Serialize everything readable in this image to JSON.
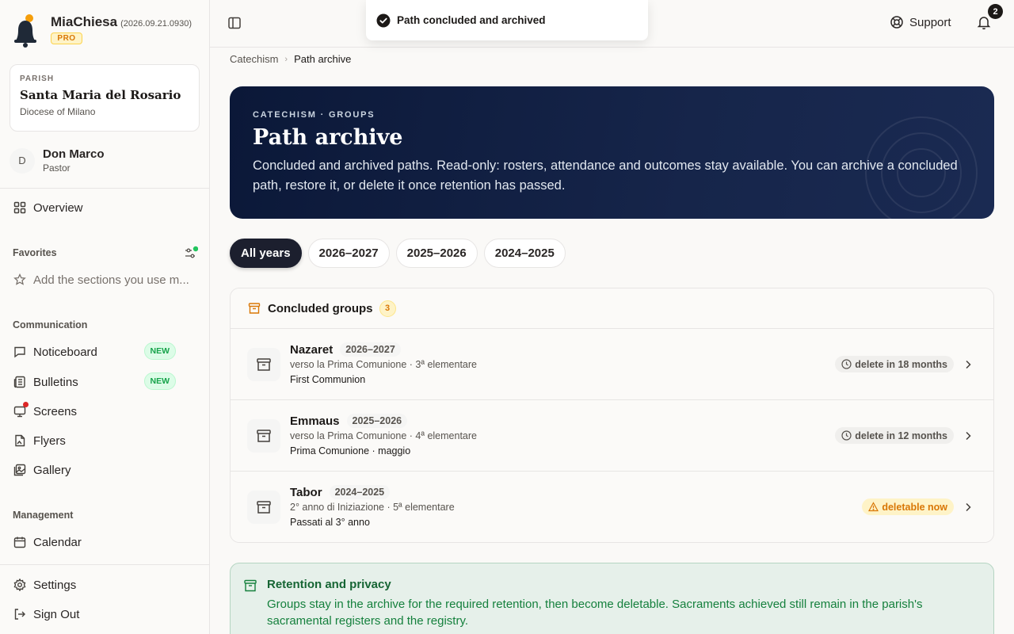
{
  "app": {
    "name": "MiaChiesa",
    "version": "(2026.09.21.0930)",
    "plan": "PRO"
  },
  "parish": {
    "label": "PARISH",
    "name": "Santa Maria del Rosario",
    "diocese": "Diocese of Milano"
  },
  "user": {
    "initial": "D",
    "name": "Don Marco",
    "role": "Pastor"
  },
  "sidebar": {
    "overview": "Overview",
    "favorites_label": "Favorites",
    "favorites_placeholder": "Add the sections you use m...",
    "communication_label": "Communication",
    "communication": [
      {
        "label": "Noticeboard",
        "badge": "NEW"
      },
      {
        "label": "Bulletins",
        "badge": "NEW"
      },
      {
        "label": "Screens"
      },
      {
        "label": "Flyers"
      },
      {
        "label": "Gallery"
      }
    ],
    "management_label": "Management",
    "management": [
      {
        "label": "Calendar"
      }
    ],
    "settings": "Settings",
    "sign_out": "Sign Out"
  },
  "header": {
    "support": "Support",
    "notifications_count": "2"
  },
  "toast": {
    "message": "Path concluded and archived"
  },
  "breadcrumb": {
    "parent": "Catechism",
    "current": "Path archive"
  },
  "hero": {
    "kicker": "CATECHISM · GROUPS",
    "title": "Path archive",
    "description": "Concluded and archived paths. Read-only: rosters, attendance and outcomes stay available. You can archive a concluded path, restore it, or delete it once retention has passed."
  },
  "filters": [
    {
      "label": "All years",
      "active": true
    },
    {
      "label": "2026–2027",
      "active": false
    },
    {
      "label": "2025–2026",
      "active": false
    },
    {
      "label": "2024–2025",
      "active": false
    }
  ],
  "groups": {
    "title": "Concluded groups",
    "count": "3",
    "rows": [
      {
        "name": "Nazaret",
        "year": "2026–2027",
        "sub": "verso la Prima Comunione · 3ª elementare",
        "note": "First Communion",
        "status": "delete in 18 months",
        "status_kind": "clock"
      },
      {
        "name": "Emmaus",
        "year": "2025–2026",
        "sub": "verso la Prima Comunione · 4ª elementare",
        "note": "Prima Comunione · maggio",
        "status": "delete in 12 months",
        "status_kind": "clock"
      },
      {
        "name": "Tabor",
        "year": "2024–2025",
        "sub": "2° anno di Iniziazione · 5ª elementare",
        "note": "Passati al 3° anno",
        "status": "deletable now",
        "status_kind": "warning"
      }
    ]
  },
  "retention": {
    "title": "Retention and privacy",
    "text": "Groups stay in the archive for the required retention, then become deletable. Sacraments achieved still remain in the parish's sacramental registers and the registry."
  },
  "colors": {
    "hero_bg": "#0b1838",
    "accent_amber": "#d97706",
    "accent_green": "#16a34a",
    "alert_red": "#dc2626"
  }
}
